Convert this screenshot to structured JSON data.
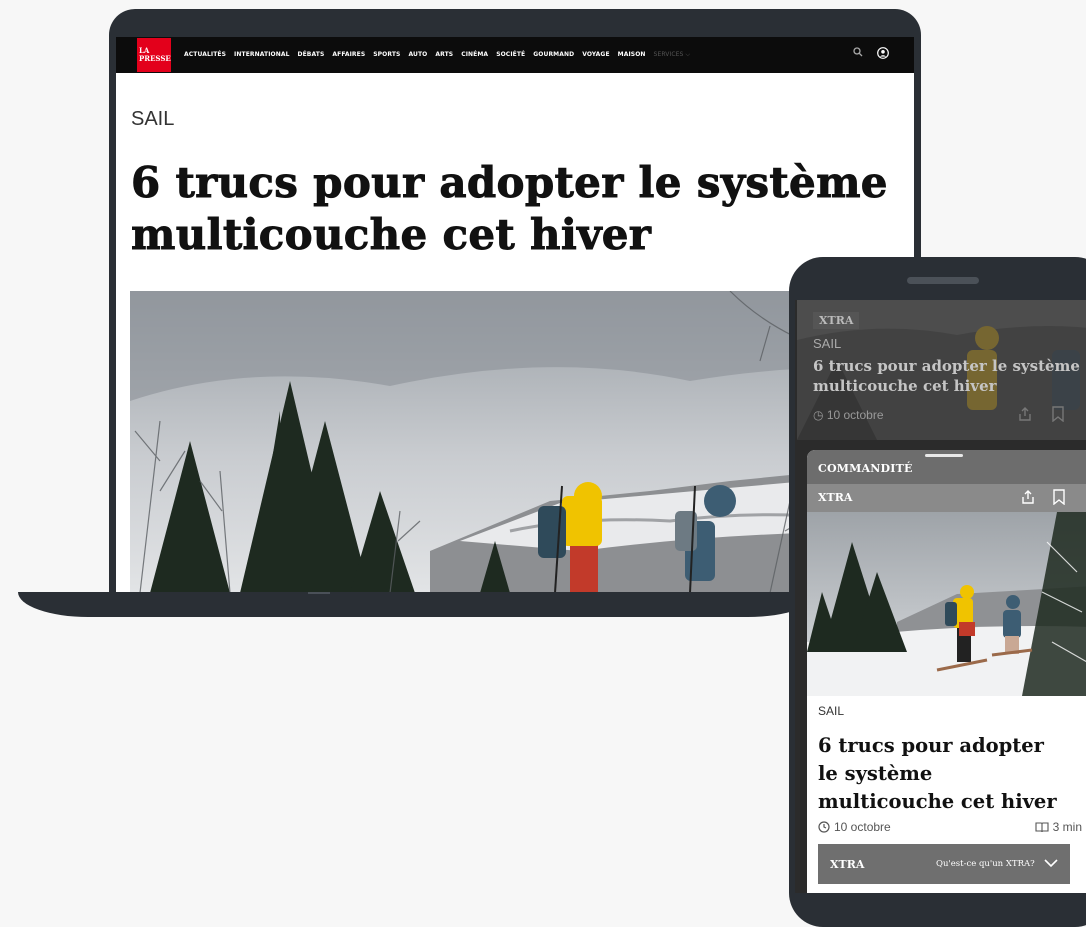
{
  "desktop": {
    "logo_line1": "LA",
    "logo_line2": "PRESSE",
    "nav": [
      "ACTUALITÉS",
      "INTERNATIONAL",
      "DÉBATS",
      "AFFAIRES",
      "SPORTS",
      "AUTO",
      "ARTS",
      "CINÉMA",
      "SOCIÉTÉ",
      "GOURMAND",
      "VOYAGE",
      "MAISON"
    ],
    "nav_services": "SERVICES",
    "icons": {
      "search": "search-icon",
      "account": "account-icon",
      "dropdown": "chevron-down-icon"
    },
    "kicker": "SAIL",
    "headline": "6 trucs pour adopter le système multicouche cet hiver"
  },
  "mobile": {
    "behind_card": {
      "tag": "XTRA",
      "kicker": "SAIL",
      "title": "6 trucs pour adopter le système multicouche cet hiver",
      "date": "10 octobre"
    },
    "sheet": {
      "sponsor_label": "COMMANDITÉ",
      "xtra_label": "XTRA",
      "kicker": "SAIL",
      "title": "6 trucs pour adopter le système multicouche cet hiver",
      "date": "10 octobre",
      "read_time": "3 min",
      "footer_label": "XTRA",
      "footer_link": "Qu'est-ce qu'un XTRA?"
    }
  },
  "colors": {
    "brand_red": "#e3001b",
    "device_frame": "#2a2f35",
    "nav_bg": "#0c0c0c"
  }
}
